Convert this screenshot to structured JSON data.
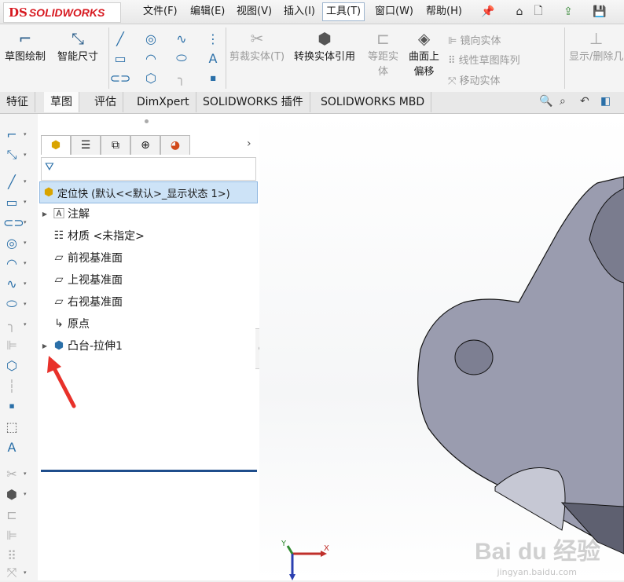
{
  "app": {
    "logo_ds": "DS",
    "logo_text": "SOLIDWORKS"
  },
  "menubar": {
    "items": [
      "文件(F)",
      "编辑(E)",
      "视图(V)",
      "插入(I)",
      "工具(T)",
      "窗口(W)",
      "帮助(H)"
    ],
    "active": "工具(T)"
  },
  "ribbon": {
    "sketch": "草图绘制",
    "smart_dim": "智能尺寸",
    "trim": "剪裁实体(T)",
    "convert": "转换实体引用",
    "equidistant": "等距实\n体",
    "surface_offset": "曲面上\n偏移",
    "mirror": "镜向实体",
    "linear_pattern": "线性草图阵列",
    "move": "移动实体",
    "show_delete": "显示/删除几"
  },
  "tabs": [
    "特征",
    "草图",
    "评估",
    "DimXpert",
    "SOLIDWORKS 插件",
    "SOLIDWORKS MBD"
  ],
  "active_tab": "草图",
  "tree": {
    "root": "定位快  (默认<<默认>_显示状态 1>)",
    "items": [
      {
        "label": "注解",
        "icon": "annotation-icon",
        "expandable": true
      },
      {
        "label": "材质 <未指定>",
        "icon": "material-icon",
        "expandable": false
      },
      {
        "label": "前视基准面",
        "icon": "plane-icon",
        "expandable": false
      },
      {
        "label": "上视基准面",
        "icon": "plane-icon",
        "expandable": false
      },
      {
        "label": "右视基准面",
        "icon": "plane-icon",
        "expandable": false
      },
      {
        "label": "原点",
        "icon": "origin-icon",
        "expandable": false
      },
      {
        "label": "凸台-拉伸1",
        "icon": "extrude-icon",
        "expandable": true
      }
    ]
  },
  "triad": {
    "x": "X",
    "y": "Y"
  },
  "watermark": {
    "main": "Bai du 经验",
    "sub": "jingyan.baidu.com"
  },
  "colors": {
    "part": "#9a9caf",
    "accent": "#d71920",
    "selection": "#cde3f7",
    "arrow": "#e8312a"
  }
}
